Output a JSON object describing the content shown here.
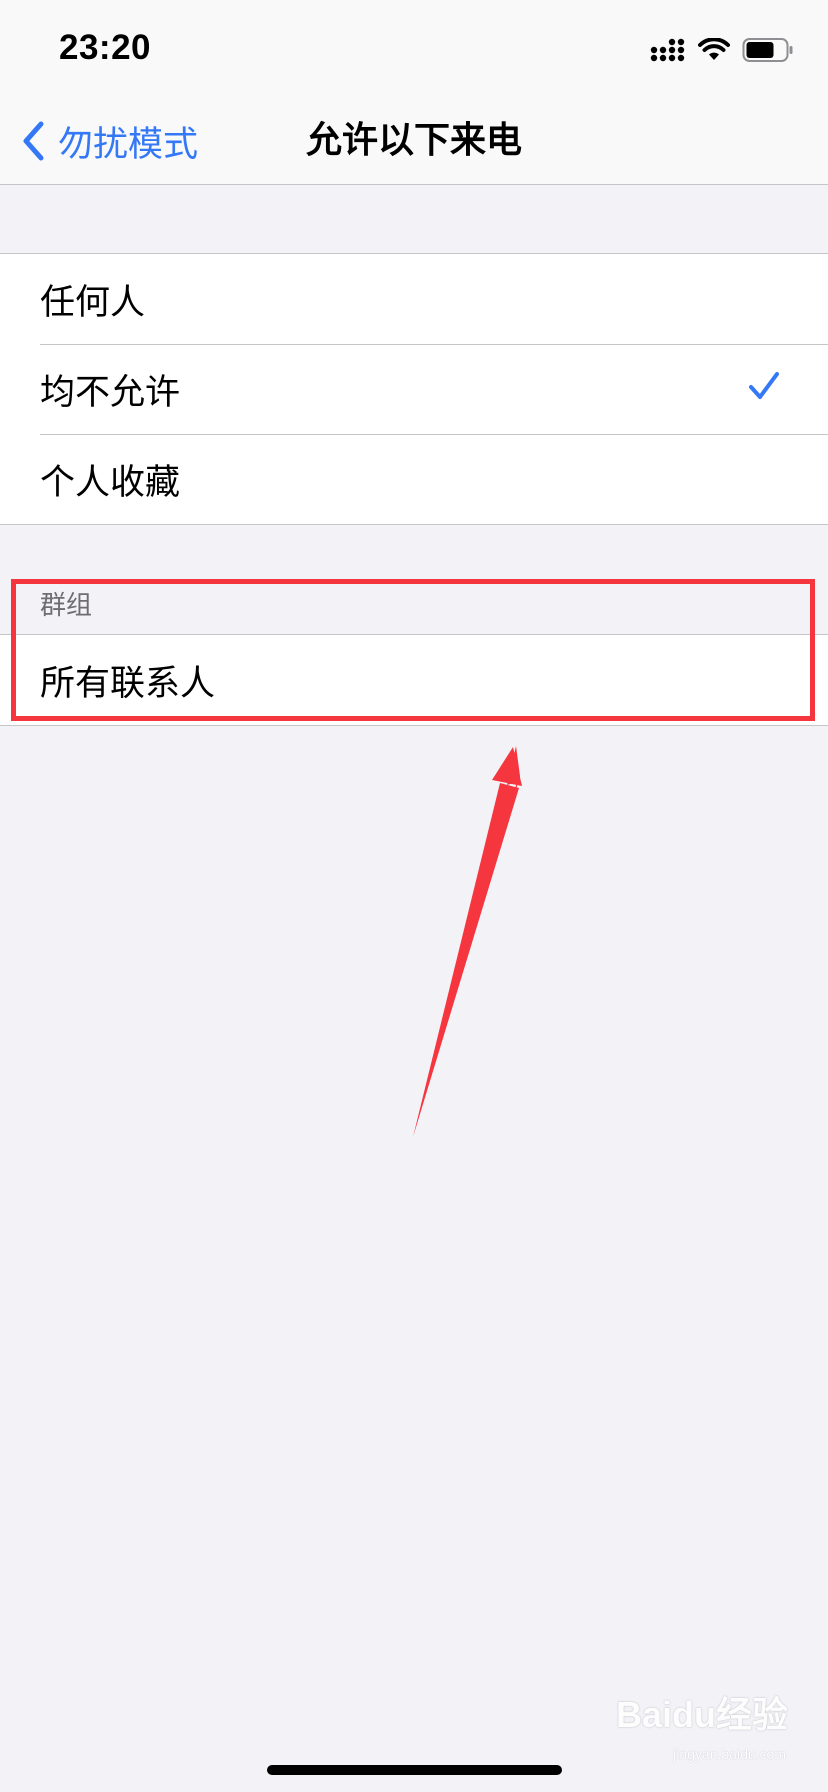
{
  "status_bar": {
    "time": "23:20",
    "icons": [
      "cellular-signal-icon",
      "wifi-icon",
      "battery-icon"
    ]
  },
  "nav": {
    "back_label": "勿扰模式",
    "title": "允许以下来电"
  },
  "options": [
    {
      "label": "任何人",
      "selected": false
    },
    {
      "label": "均不允许",
      "selected": true
    },
    {
      "label": "个人收藏",
      "selected": false
    }
  ],
  "groups": {
    "header": "群组",
    "items": [
      {
        "label": "所有联系人"
      }
    ]
  },
  "colors": {
    "accent": "#3478f6",
    "annotation": "#f5363f",
    "background": "#f2f2f7"
  },
  "watermark": {
    "text": "Baidu经验",
    "sub": "jingyan.baidu.com"
  }
}
